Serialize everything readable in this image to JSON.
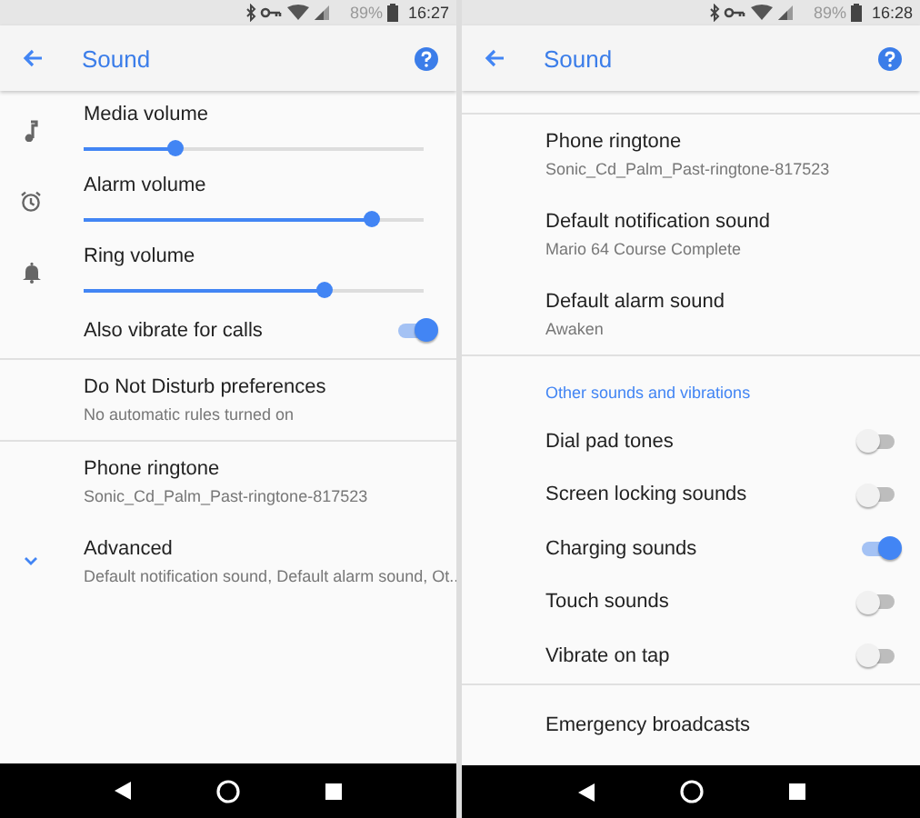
{
  "screens": [
    {
      "status_bar": {
        "battery": "89%",
        "time": "16:27"
      },
      "title": "Sound",
      "items": [
        {
          "kind": "slider",
          "label": "Media volume",
          "level": 0.27
        },
        {
          "kind": "slider",
          "label": "Alarm volume",
          "level": 0.85
        },
        {
          "kind": "slider",
          "label": "Ring volume",
          "level": 0.71
        },
        {
          "kind": "toggle",
          "label": "Also vibrate for calls",
          "on": true
        },
        {
          "kind": "divider"
        },
        {
          "kind": "entry",
          "title": "Do Not Disturb preferences",
          "subtitle": "No automatic rules turned on"
        },
        {
          "kind": "divider"
        },
        {
          "kind": "entry",
          "title": "Phone ringtone",
          "subtitle": "Sonic_Cd_Palm_Past-ringtone-817523"
        },
        {
          "kind": "expander",
          "title": "Advanced",
          "subtitle": "Default notification sound, Default alarm sound, Ot.."
        }
      ]
    },
    {
      "status_bar": {
        "battery": "89%",
        "time": "16:28"
      },
      "title": "Sound",
      "items": [
        {
          "kind": "divider"
        },
        {
          "kind": "entry",
          "title": "Phone ringtone",
          "subtitle": "Sonic_Cd_Palm_Past-ringtone-817523"
        },
        {
          "kind": "entry",
          "title": "Default notification sound",
          "subtitle": "Mario 64 Course Complete"
        },
        {
          "kind": "entry",
          "title": "Default alarm sound",
          "subtitle": "Awaken"
        },
        {
          "kind": "divider"
        },
        {
          "kind": "header",
          "label": "Other sounds and vibrations"
        },
        {
          "kind": "toggle",
          "label": "Dial pad tones",
          "on": false
        },
        {
          "kind": "toggle",
          "label": "Screen locking sounds",
          "on": false
        },
        {
          "kind": "toggle",
          "label": "Charging sounds",
          "on": true
        },
        {
          "kind": "toggle",
          "label": "Touch sounds",
          "on": false
        },
        {
          "kind": "toggle",
          "label": "Vibrate on tap",
          "on": false
        },
        {
          "kind": "divider"
        },
        {
          "kind": "entry",
          "title": "Emergency broadcasts"
        }
      ]
    }
  ]
}
